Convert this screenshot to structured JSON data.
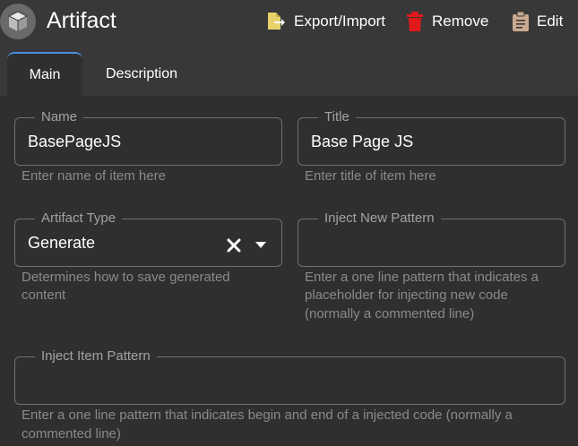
{
  "header": {
    "title": "Artifact",
    "export_import_label": "Export/Import",
    "remove_label": "Remove",
    "edit_label": "Edit"
  },
  "tabs": [
    {
      "label": "Main",
      "active": true
    },
    {
      "label": "Description",
      "active": false
    }
  ],
  "form": {
    "name": {
      "legend": "Name",
      "value": "BasePageJS",
      "hint": "Enter name of item here"
    },
    "title": {
      "legend": "Title",
      "value": "Base Page JS",
      "hint": "Enter title of item here"
    },
    "artifact_type": {
      "legend": "Artifact Type",
      "value": "Generate",
      "hint_line1": "Determines how to save generated",
      "hint_line2": "content"
    },
    "inject_new_pattern": {
      "legend": "Inject New Pattern",
      "value": "",
      "hint_line1": "Enter a one line pattern that indicates a",
      "hint_line2": "placeholder for injecting new code",
      "hint_line3": "(normally a commented line)"
    },
    "inject_item_pattern": {
      "legend": "Inject Item Pattern",
      "value": "",
      "hint_line1": "Enter a one line pattern that indicates begin and end of a injected code (normally a",
      "hint_line2": "commented line)"
    }
  },
  "colors": {
    "background": "#2f2f2f",
    "header": "#383838",
    "tab_indicator": "#4a90e2",
    "export_icon": "#e8d36a",
    "remove_icon": "#e01a1a",
    "edit_icon": "#c9a98f"
  },
  "icons": {
    "app": "cube-icon",
    "export_import": "file-export-icon",
    "remove": "trash-icon",
    "edit": "clipboard-icon",
    "clear": "close-icon",
    "dropdown": "caret-down-icon"
  }
}
